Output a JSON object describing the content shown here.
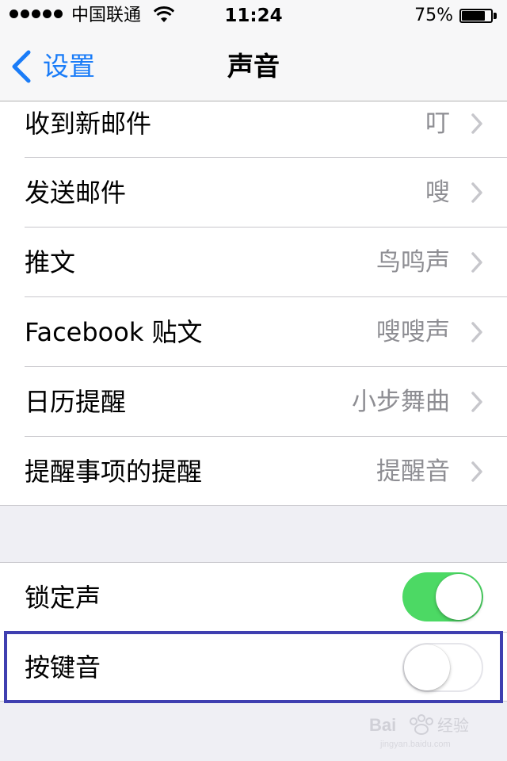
{
  "status_bar": {
    "carrier": "中国联通",
    "time": "11:24",
    "battery_percent": "75%",
    "battery_level": 0.75,
    "signal_bars": 5,
    "wifi_icon": "wifi-icon"
  },
  "nav": {
    "back_label": "设置",
    "title": "声音"
  },
  "sounds_list": [
    {
      "label": "收到新邮件",
      "value": "叮"
    },
    {
      "label": "发送邮件",
      "value": "嗖"
    },
    {
      "label": "推文",
      "value": "鸟鸣声"
    },
    {
      "label": "Facebook 贴文",
      "value": "嗖嗖声"
    },
    {
      "label": "日历提醒",
      "value": "小步舞曲"
    },
    {
      "label": "提醒事项的提醒",
      "value": "提醒音"
    }
  ],
  "toggles": [
    {
      "label": "锁定声",
      "on": true
    },
    {
      "label": "按键音",
      "on": false
    }
  ],
  "colors": {
    "accent": "#1a7cf8",
    "toggle_on": "#4cd964",
    "highlight_border": "#3f3fb0",
    "background": "#efeff4"
  }
}
